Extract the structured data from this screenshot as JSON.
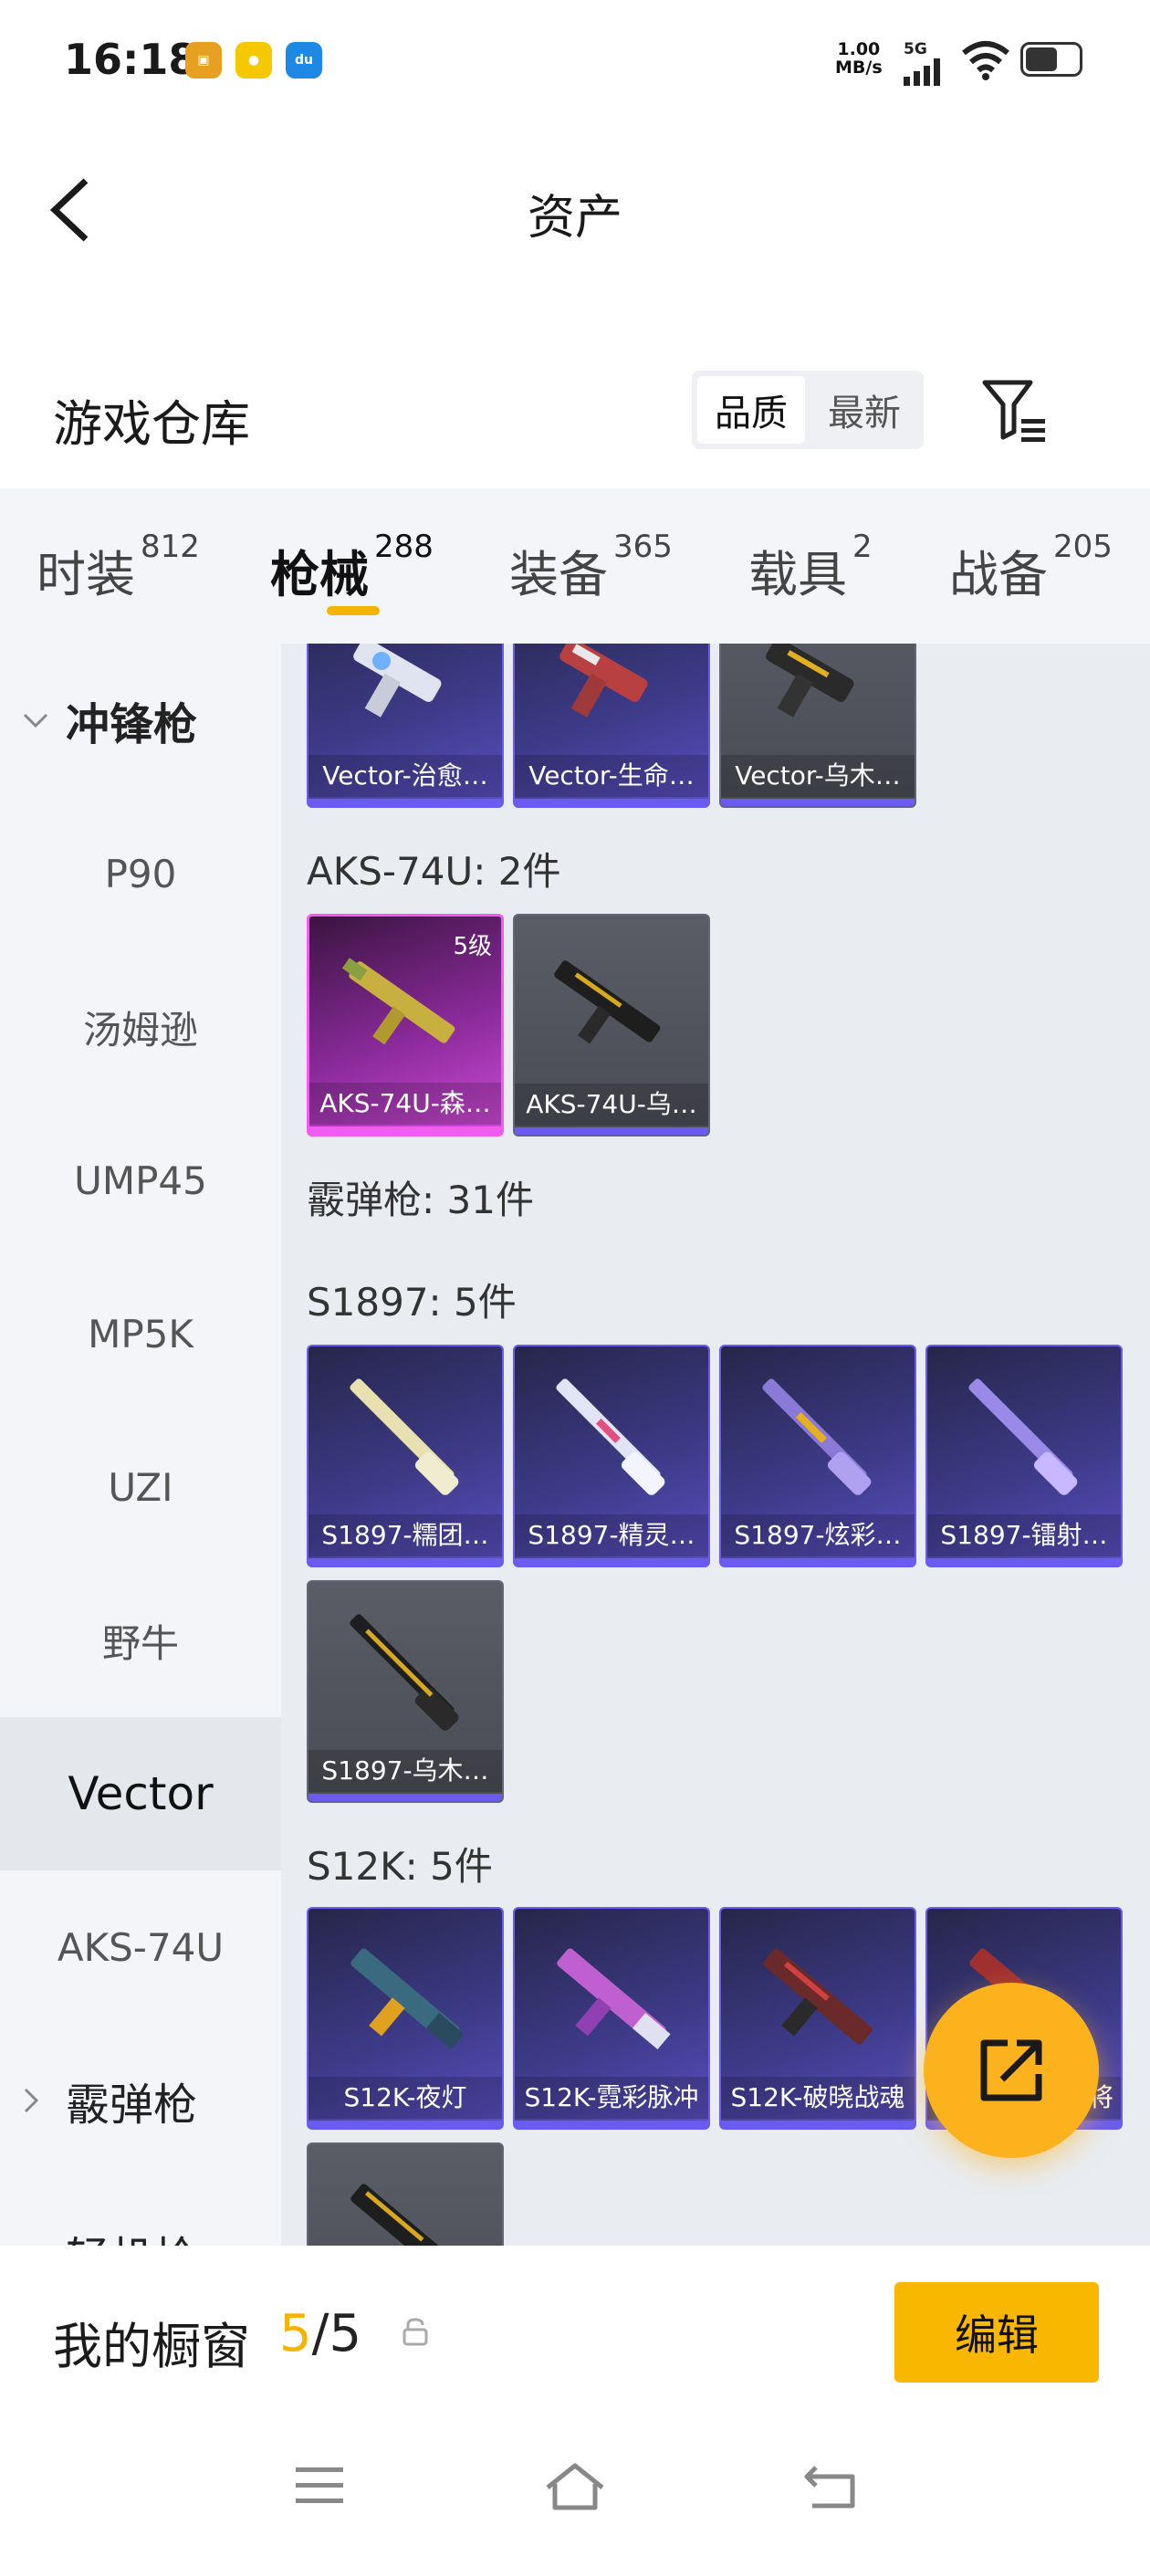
{
  "status_bar": {
    "time": "16:18",
    "net_speed_value": "1.00",
    "net_speed_unit": "MB/s",
    "signal": "5G",
    "battery_level": 0.6
  },
  "nav": {
    "title": "资产"
  },
  "header": {
    "title": "游戏仓库",
    "sort_quality": "品质",
    "sort_latest": "最新"
  },
  "tabs": [
    {
      "label": "时装",
      "count": "812"
    },
    {
      "label": "枪械",
      "count": "288"
    },
    {
      "label": "装备",
      "count": "365"
    },
    {
      "label": "载具",
      "count": "2"
    },
    {
      "label": "战备",
      "count": "205"
    }
  ],
  "sidebar": {
    "category_smg": "冲锋枪",
    "items": [
      "P90",
      "汤姆逊",
      "UMP45",
      "MP5K",
      "UZI",
      "野牛",
      "Vector",
      "AKS-74U"
    ],
    "category_shotgun": "霰弹枪",
    "category_partial": "轻机枪"
  },
  "content": {
    "vector_cards": [
      "Vector-治愈…",
      "Vector-生命…",
      "Vector-乌木…"
    ],
    "aks_title": "AKS-74U: 2件",
    "aks_cards": [
      "AKS-74U-森…",
      "AKS-74U-乌…"
    ],
    "aks_level": "5级",
    "shotgun_title": "霰弹枪: 31件",
    "s1897_title": "S1897: 5件",
    "s1897_cards": [
      "S1897-糯团…",
      "S1897-精灵…",
      "S1897-炫彩…",
      "S1897-镭射…",
      "S1897-乌木…"
    ],
    "s12k_title": "S12K: 5件",
    "s12k_cards": [
      "S12K-夜灯",
      "S12K-霓彩脉冲",
      "S12K-破晓战魂",
      "将"
    ]
  },
  "showcase": {
    "label": "我的橱窗",
    "current": "5",
    "separator": "/",
    "total": "5",
    "edit": "编辑"
  },
  "colors": {
    "accent": "#f5b400",
    "purple_rarity": "#6a5cf0",
    "pink_rarity": "#f05cf0",
    "fab": "#fbb21c"
  }
}
